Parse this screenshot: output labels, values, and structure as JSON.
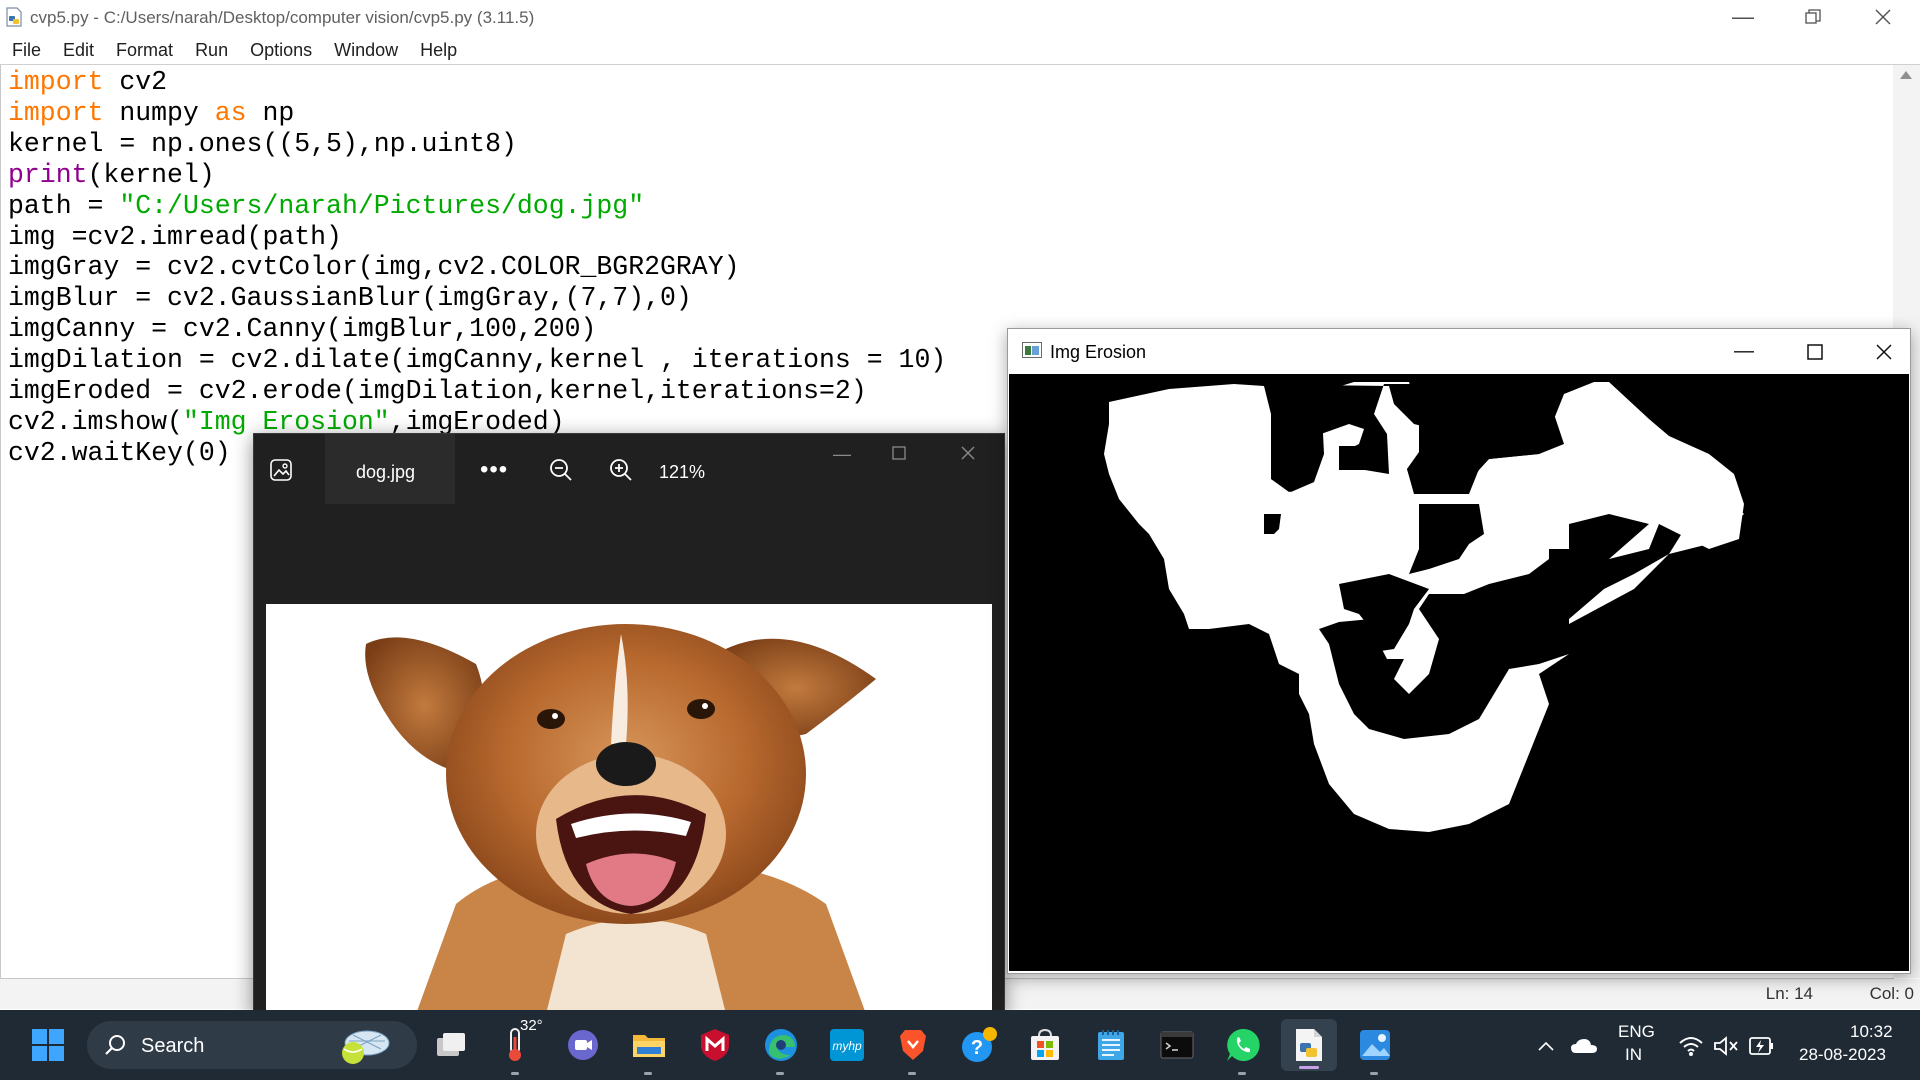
{
  "idle": {
    "title": "cvp5.py - C:/Users/narah/Desktop/computer vision/cvp5.py (3.11.5)",
    "menu": [
      "File",
      "Edit",
      "Format",
      "Run",
      "Options",
      "Window",
      "Help"
    ],
    "status": {
      "line": "Ln: 14",
      "col": "Col: 0"
    },
    "code_lines": [
      "import cv2",
      "import numpy as np",
      "kernel = np.ones((5,5),np.uint8)",
      "print(kernel)",
      "path = \"C:/Users/narah/Pictures/dog.jpg\"",
      "img =cv2.imread(path)",
      "imgGray = cv2.cvtColor(img,cv2.COLOR_BGR2GRAY)",
      "imgBlur = cv2.GaussianBlur(imgGray,(7,7),0)",
      "imgCanny = cv2.Canny(imgBlur,100,200)",
      "imgDilation = cv2.dilate(imgCanny,kernel , iterations = 10)",
      "imgEroded = cv2.erode(imgDilation,kernel,iterations=2)",
      "cv2.imshow(\"Img Erosion\",imgEroded)",
      "cv2.waitKey(0)"
    ]
  },
  "photos": {
    "filename": "dog.jpg",
    "more": "•••",
    "zoom": "121%"
  },
  "cv_window": {
    "title": "Img Erosion"
  },
  "taskbar": {
    "search_label": "Search",
    "weather_temp": "32°",
    "lang_line1": "ENG",
    "lang_line2": "IN",
    "time": "10:32",
    "date": "28-08-2023",
    "apps": [
      "start-icon",
      "search-icon",
      "task-view-icon",
      "weather-icon",
      "teams-chat-icon",
      "file-explorer-icon",
      "mcafee-icon",
      "edge-icon",
      "myhp-icon",
      "brave-icon",
      "help-icon",
      "microsoft-store-icon",
      "notepad-icon",
      "terminal-icon",
      "whatsapp-icon",
      "python-idle-icon",
      "photos-icon"
    ]
  },
  "colors": {
    "keyword": "#ff7700",
    "builtin": "#900090",
    "string": "#00aa00",
    "taskbar": "#1f2a35"
  }
}
